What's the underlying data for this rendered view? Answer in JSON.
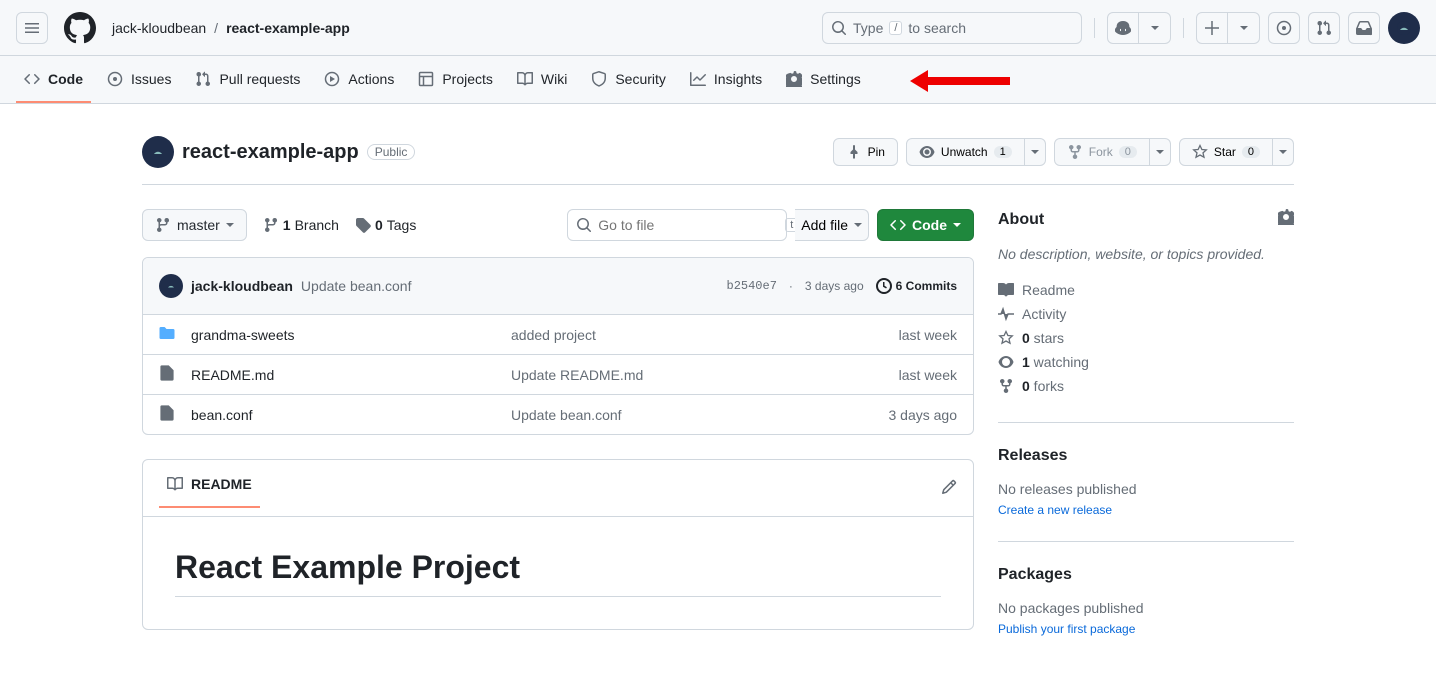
{
  "header": {
    "owner": "jack-kloudbean",
    "repo": "react-example-app",
    "search_text_before": "Type",
    "search_key": "/",
    "search_text_after": "to search"
  },
  "nav": {
    "code": "Code",
    "issues": "Issues",
    "pulls": "Pull requests",
    "actions": "Actions",
    "projects": "Projects",
    "wiki": "Wiki",
    "security": "Security",
    "insights": "Insights",
    "settings": "Settings"
  },
  "repo": {
    "name": "react-example-app",
    "visibility": "Public",
    "pin": "Pin",
    "unwatch": "Unwatch",
    "watch_count": "1",
    "fork": "Fork",
    "fork_count": "0",
    "star": "Star",
    "star_count": "0"
  },
  "codebar": {
    "branch": "master",
    "branches_prefix": "1",
    "branches_label": " Branch",
    "tags_prefix": "0",
    "tags_label": " Tags",
    "goto_placeholder": "Go to file",
    "goto_key": "t",
    "addfile": "Add file",
    "codebtn": "Code"
  },
  "commit": {
    "author": "jack-kloudbean",
    "message": "Update bean.conf",
    "sha": "b2540e7",
    "time": "3 days ago",
    "count_label": "6 Commits"
  },
  "files": [
    {
      "type": "dir",
      "name": "grandma-sweets",
      "msg": "added project",
      "time": "last week"
    },
    {
      "type": "file",
      "name": "README.md",
      "msg": "Update README.md",
      "time": "last week"
    },
    {
      "type": "file",
      "name": "bean.conf",
      "msg": "Update bean.conf",
      "time": "3 days ago"
    }
  ],
  "readme": {
    "tab": "README",
    "heading": "React Example Project"
  },
  "about": {
    "title": "About",
    "desc": "No description, website, or topics provided.",
    "readme": "Readme",
    "activity": "Activity",
    "stars_num": "0",
    "stars_text": " stars",
    "watch_num": "1",
    "watch_text": " watching",
    "forks_num": "0",
    "forks_text": " forks"
  },
  "releases": {
    "title": "Releases",
    "text": "No releases published",
    "link": "Create a new release"
  },
  "packages": {
    "title": "Packages",
    "text": "No packages published",
    "link": "Publish your first package"
  }
}
